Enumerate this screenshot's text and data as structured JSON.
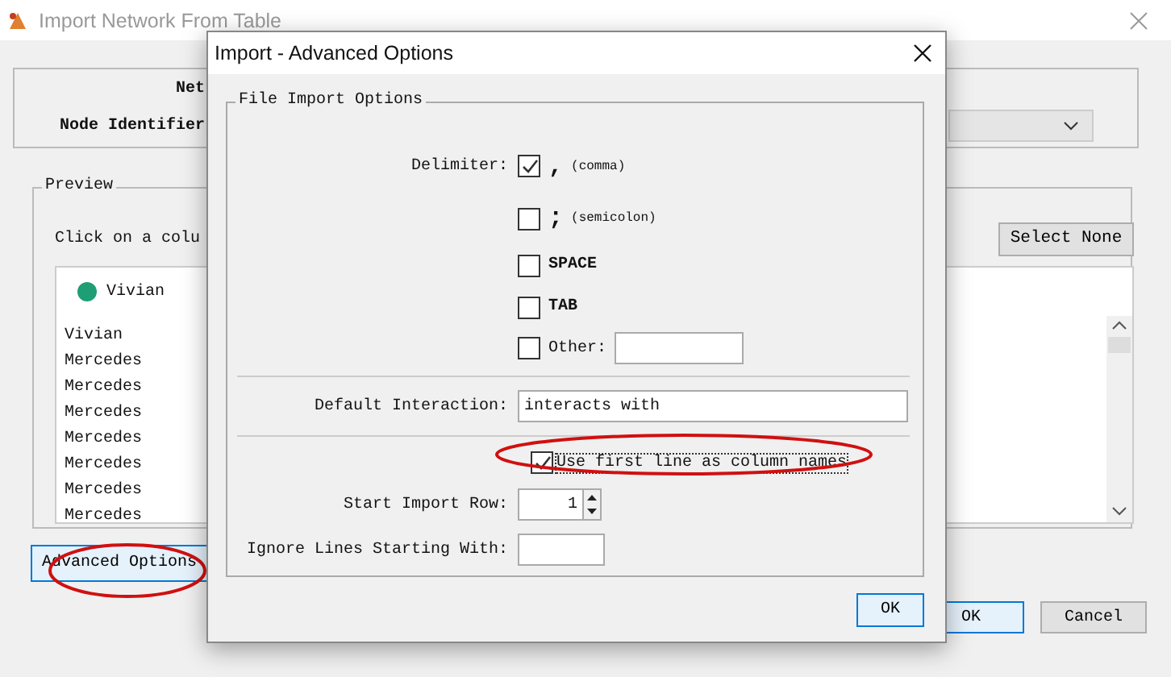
{
  "window": {
    "title": "Import Network From Table"
  },
  "network_group": {
    "label_1": "Net",
    "label_2": "Node Identifier"
  },
  "preview": {
    "title": "Preview",
    "instruction": "Click on a colu",
    "select_none_button": "Select None",
    "column_name": "Vivian",
    "rows": [
      "Vivian",
      "Mercedes",
      "Mercedes",
      "Mercedes",
      "Mercedes",
      "Mercedes",
      "Mercedes",
      "Mercedes"
    ]
  },
  "advanced_options_button": "Advanced Options",
  "buttons": [
    "OK",
    "Cancel"
  ],
  "dialog": {
    "title": "Import - Advanced Options",
    "group_title": "File Import Options",
    "delimiter_label": "Delimiter:",
    "delimiters": [
      {
        "kind": "symbol",
        "symbol": ",",
        "note": "(comma)",
        "checked": true
      },
      {
        "kind": "symbol",
        "symbol": ";",
        "note": "(semicolon)",
        "checked": false
      },
      {
        "kind": "named",
        "label": "SPACE",
        "checked": false
      },
      {
        "kind": "named",
        "label": "TAB",
        "checked": false
      },
      {
        "kind": "other",
        "label": "Other:",
        "checked": false
      }
    ],
    "default_interaction": {
      "label": "Default Interaction:",
      "value": "interacts with"
    },
    "first_line": {
      "label": "Use first line as column names",
      "checked": true
    },
    "start_row": {
      "label": "Start Import Row:",
      "value": "1"
    },
    "ignore_lines": {
      "label": "Ignore Lines Starting With:"
    },
    "ok_button": "OK"
  }
}
